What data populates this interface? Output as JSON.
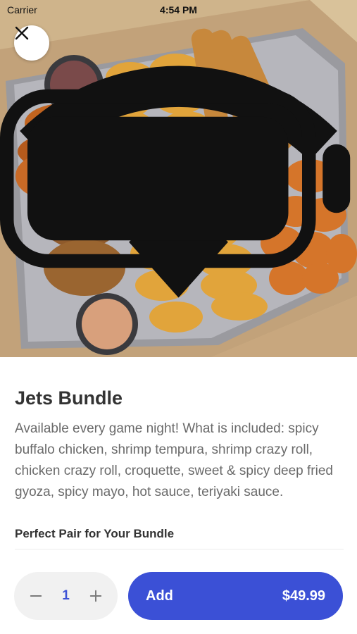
{
  "status_bar": {
    "carrier": "Carrier",
    "time": "4:54 PM"
  },
  "hero": {
    "image": "Photo of a takeout box with sauces, tempura, gyoza and sushi rolls"
  },
  "item": {
    "title": "Jets Bundle",
    "description": "Available every game night! What is included: spicy buffalo chicken, shrimp tempura, shrimp crazy roll, chicken crazy roll, croquette, sweet & spicy deep fried gyoza, spicy mayo, hot sauce, teriyaki sauce."
  },
  "pairing": {
    "heading": "Perfect Pair for Your Bundle"
  },
  "footer": {
    "quantity": "1",
    "add_label": "Add",
    "price": "$49.99"
  },
  "colors": {
    "accent": "#3b50d6",
    "text_primary": "#333333",
    "text_secondary": "#6a6a6a",
    "stepper_bg": "#f1f1f1"
  }
}
